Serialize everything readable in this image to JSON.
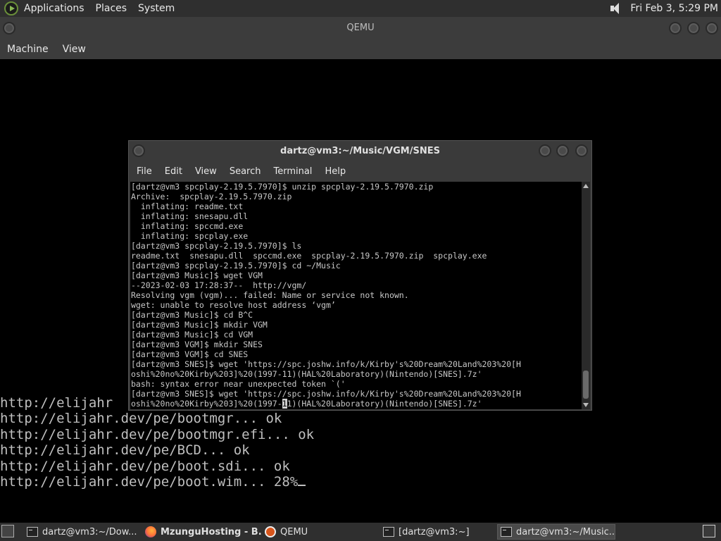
{
  "topbar": {
    "menus": [
      "Applications",
      "Places",
      "System"
    ],
    "clock": "Fri Feb  3,  5:29 PM"
  },
  "qemu": {
    "title": "QEMU",
    "menus": [
      "Machine",
      "View"
    ]
  },
  "boot_lines": [
    "http://elijahr",
    "http://elijahr.dev/pe/bootmgr... ok",
    "http://elijahr.dev/pe/bootmgr.efi... ok",
    "http://elijahr.dev/pe/BCD... ok",
    "http://elijahr.dev/pe/boot.sdi... ok",
    "http://elijahr.dev/pe/boot.wim... 28%"
  ],
  "terminal": {
    "title": "dartz@vm3:~/Music/VGM/SNES",
    "menus": [
      "File",
      "Edit",
      "View",
      "Search",
      "Terminal",
      "Help"
    ],
    "lines": [
      "[dartz@vm3 spcplay-2.19.5.7970]$ unzip spcplay-2.19.5.7970.zip",
      "Archive:  spcplay-2.19.5.7970.zip",
      "  inflating: readme.txt",
      "  inflating: snesapu.dll",
      "  inflating: spccmd.exe",
      "  inflating: spcplay.exe",
      "[dartz@vm3 spcplay-2.19.5.7970]$ ls",
      "readme.txt  snesapu.dll  spccmd.exe  spcplay-2.19.5.7970.zip  spcplay.exe",
      "[dartz@vm3 spcplay-2.19.5.7970]$ cd ~/Music",
      "[dartz@vm3 Music]$ wget VGM",
      "--2023-02-03 17:28:37--  http://vgm/",
      "Resolving vgm (vgm)... failed: Name or service not known.",
      "wget: unable to resolve host address ‘vgm’",
      "[dartz@vm3 Music]$ cd B^C",
      "[dartz@vm3 Music]$ mkdir VGM",
      "[dartz@vm3 Music]$ cd VGM",
      "[dartz@vm3 VGM]$ mkdir SNES",
      "[dartz@vm3 VGM]$ cd SNES",
      "[dartz@vm3 SNES]$ wget 'https://spc.joshw.info/k/Kirby's%20Dream%20Land%203%20[H",
      "oshi%20no%20Kirby%203]%20(1997-11)(HAL%20Laboratory)(Nintendo)[SNES].7z'",
      "bash: syntax error near unexpected token `('",
      "[dartz@vm3 SNES]$ wget 'https://spc.joshw.info/k/Kirby's%20Dream%20Land%203%20[H"
    ],
    "last_line_before_cursor": "oshi%20no%20Kirby%203]%20(1997-",
    "cursor_char": "1",
    "last_line_after_cursor": "1)(HAL%20Laboratory)(Nintendo)[SNES].7z'"
  },
  "taskbar": {
    "items": [
      "dartz@vm3:~/Dow...",
      "MzunguHosting - B...",
      "QEMU",
      "[dartz@vm3:~]",
      "dartz@vm3:~/Music..."
    ]
  }
}
